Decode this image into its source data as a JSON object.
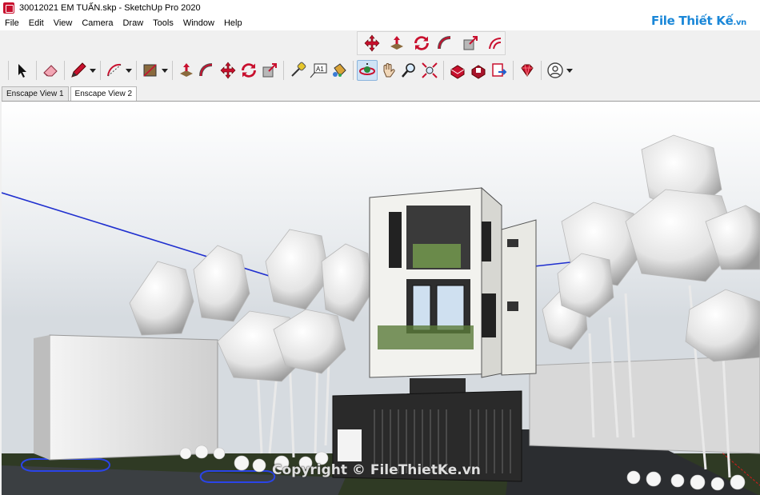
{
  "window": {
    "title": "30012021 EM TUẤN.skp - SketchUp Pro 2020"
  },
  "menu": [
    "File",
    "Edit",
    "View",
    "Camera",
    "Draw",
    "Tools",
    "Window",
    "Help"
  ],
  "watermark": {
    "brand": "File Thiết Kế",
    "tld": ".vn",
    "copyright": "Copyright © FileThietKe.vn"
  },
  "colors": {
    "accent_red": "#c8102e",
    "brand_blue": "#1a87d8",
    "axis_blue": "#1f2fcf",
    "axis_red": "#d41a1a",
    "ground_green": "#2f3a24"
  },
  "toolbar_top": [
    "move-icon",
    "push-pull-icon",
    "rotate-icon",
    "follow-me-icon",
    "scale-icon",
    "offset-icon"
  ],
  "toolbar_main": {
    "groups": [
      [
        "select-icon",
        "eraser-icon",
        "pencil-icon",
        "arc-icon",
        "rectangle-icon"
      ],
      [
        "push-pull-icon",
        "follow-me-icon",
        "move-icon",
        "rotate-icon",
        "scale-icon"
      ],
      [
        "tape-measure-icon",
        "text-icon",
        "paint-bucket-icon"
      ],
      [
        "orbit-icon",
        "pan-icon",
        "zoom-icon",
        "zoom-extents-icon"
      ],
      [
        "warehouse-icon",
        "extension-warehouse-icon",
        "send-to-layout-icon"
      ],
      [
        "ruby-console-icon"
      ],
      [
        "account-icon"
      ]
    ],
    "text_tool_label": "A1"
  },
  "scene_tabs": [
    {
      "label": "Enscape View 1",
      "selected": false
    },
    {
      "label": "Enscape View 2",
      "selected": true
    }
  ]
}
